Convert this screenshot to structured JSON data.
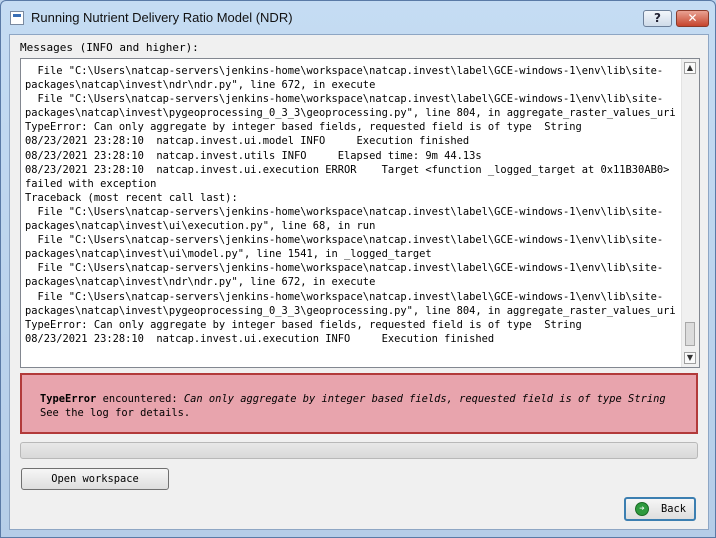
{
  "window": {
    "title": "Running Nutrient Delivery Ratio Model (NDR)",
    "help_label": "?",
    "close_label": "✕"
  },
  "messages": {
    "label": "Messages (INFO and higher):",
    "log_lines": [
      "  File \"C:\\Users\\natcap-servers\\jenkins-home\\workspace\\natcap.invest\\label\\GCE-windows-1\\env\\lib\\site-",
      "packages\\natcap\\invest\\ndr\\ndr.py\", line 672, in execute",
      "  File \"C:\\Users\\natcap-servers\\jenkins-home\\workspace\\natcap.invest\\label\\GCE-windows-1\\env\\lib\\site-",
      "packages\\natcap\\invest\\pygeoprocessing_0_3_3\\geoprocessing.py\", line 804, in aggregate_raster_values_uri",
      "TypeError: Can only aggregate by integer based fields, requested field is of type  String",
      "08/23/2021 23:28:10  natcap.invest.ui.model INFO     Execution finished",
      "08/23/2021 23:28:10  natcap.invest.utils INFO     Elapsed time: 9m 44.13s",
      "08/23/2021 23:28:10  natcap.invest.ui.execution ERROR    Target <function _logged_target at 0x11B30AB0>",
      "failed with exception",
      "Traceback (most recent call last):",
      "  File \"C:\\Users\\natcap-servers\\jenkins-home\\workspace\\natcap.invest\\label\\GCE-windows-1\\env\\lib\\site-",
      "packages\\natcap\\invest\\ui\\execution.py\", line 68, in run",
      "  File \"C:\\Users\\natcap-servers\\jenkins-home\\workspace\\natcap.invest\\label\\GCE-windows-1\\env\\lib\\site-",
      "packages\\natcap\\invest\\ui\\model.py\", line 1541, in _logged_target",
      "  File \"C:\\Users\\natcap-servers\\jenkins-home\\workspace\\natcap.invest\\label\\GCE-windows-1\\env\\lib\\site-",
      "packages\\natcap\\invest\\ndr\\ndr.py\", line 672, in execute",
      "  File \"C:\\Users\\natcap-servers\\jenkins-home\\workspace\\natcap.invest\\label\\GCE-windows-1\\env\\lib\\site-",
      "packages\\natcap\\invest\\pygeoprocessing_0_3_3\\geoprocessing.py\", line 804, in aggregate_raster_values_uri",
      "TypeError: Can only aggregate by integer based fields, requested field is of type  String",
      "08/23/2021 23:28:10  natcap.invest.ui.execution INFO     Execution finished"
    ],
    "scroll_up": "▲",
    "scroll_down": "▼"
  },
  "error": {
    "type": "TypeError",
    "encountered": " encountered: ",
    "message": "Can only aggregate by integer based fields, requested field is of type String",
    "see_log": "See the log for details."
  },
  "progress": {
    "value": 0
  },
  "buttons": {
    "open_workspace": "Open workspace",
    "back": "Back",
    "back_icon": "➔"
  },
  "colors": {
    "error_bg": "#e8a4ad",
    "error_border": "#b23a3a",
    "back_icon": "#2e9a3e"
  }
}
